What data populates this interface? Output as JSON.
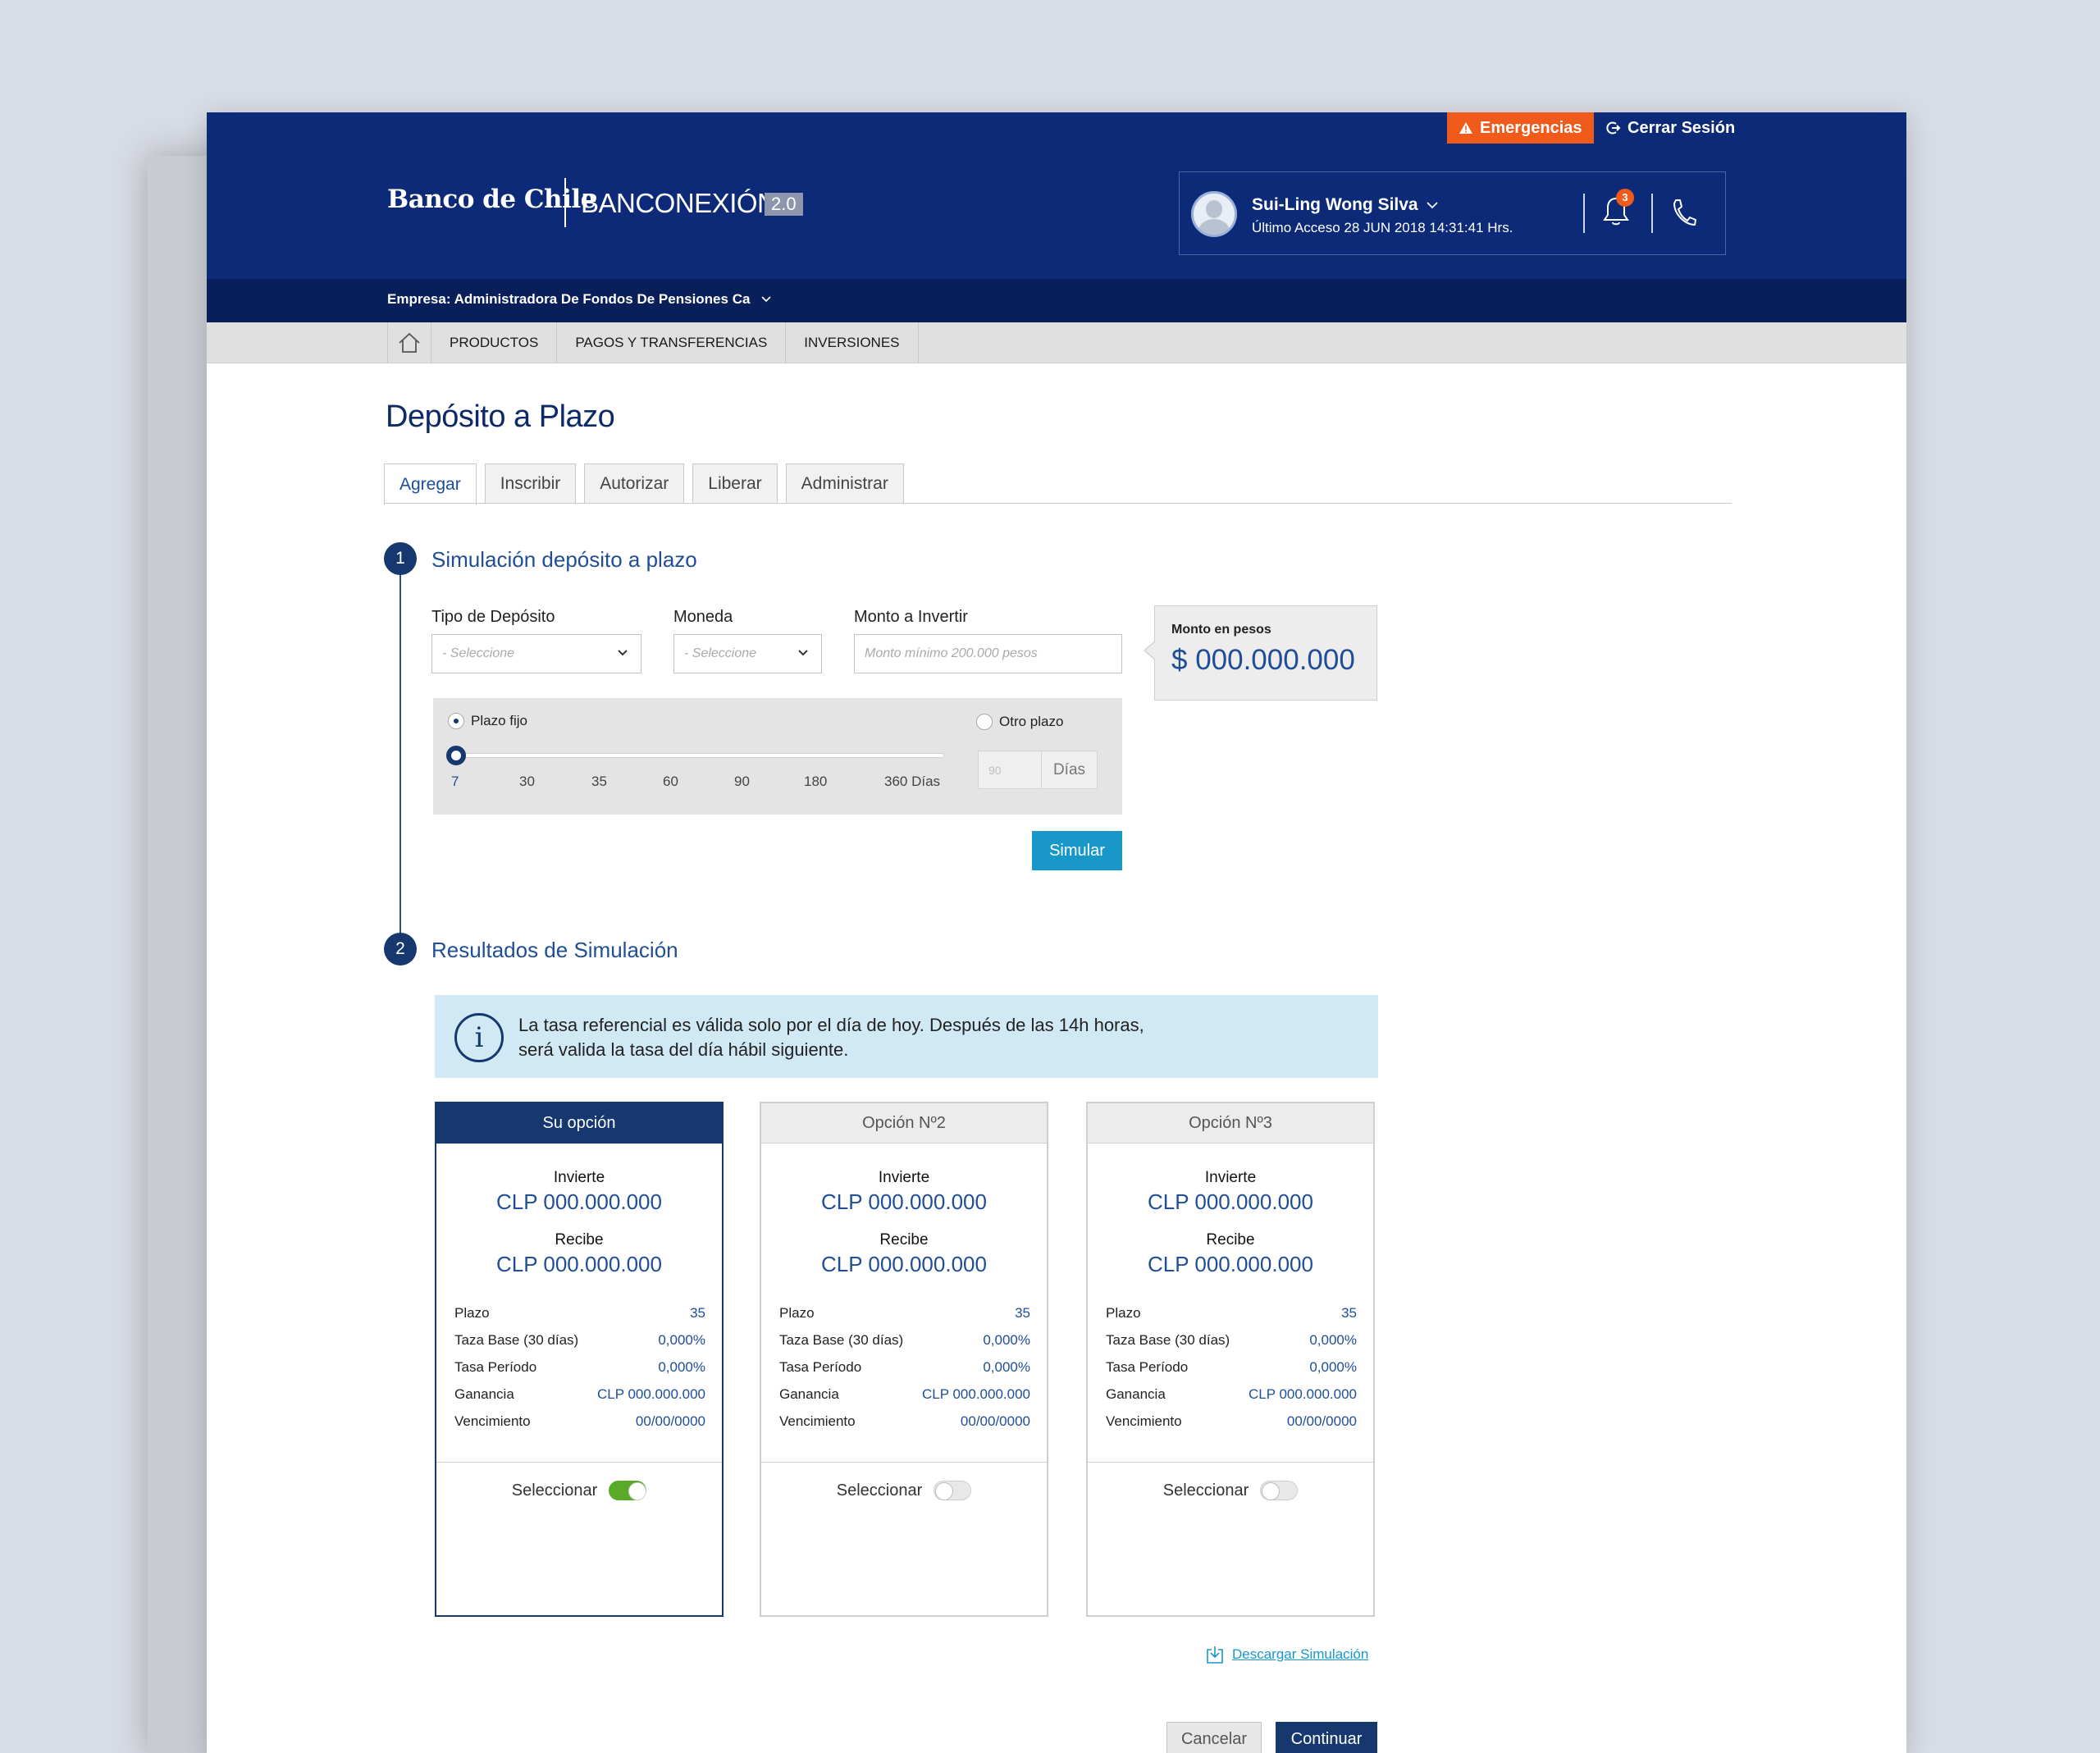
{
  "header": {
    "emergency_label": "Emergencias",
    "logout_label": "Cerrar Sesión",
    "bank_name": "Banco de Chile",
    "app_name": "BANCONEXIÓN",
    "app_version": "2.0",
    "user_name": "Sui-Ling Wong Silva",
    "last_access": "Último Acceso 28 JUN 2018 14:31:41 Hrs.",
    "notification_count": "3",
    "company": "Empresa: Administradora De Fondos De Pensiones Ca"
  },
  "nav": {
    "items": [
      "PRODUCTOS",
      "PAGOS Y TRANSFERENCIAS",
      "INVERSIONES"
    ]
  },
  "page": {
    "title": "Depósito a Plazo",
    "tabs": [
      "Agregar",
      "Inscribir",
      "Autorizar",
      "Liberar",
      "Administrar"
    ],
    "active_tab": "Agregar"
  },
  "step1": {
    "number": "1",
    "title": "Simulación depósito a plazo",
    "tipo_label": "Tipo de Depósito",
    "tipo_placeholder": "- Seleccione",
    "moneda_label": "Moneda",
    "moneda_placeholder": "- Seleccione",
    "monto_label": "Monto a Invertir",
    "monto_placeholder": "Monto mínimo 200.000 pesos",
    "monto_pesos_label": "Monto en pesos",
    "monto_pesos_value": "$ 000.000.000",
    "plazo_fijo_label": "Plazo fijo",
    "otro_plazo_label": "Otro plazo",
    "ticks": [
      "7",
      "30",
      "35",
      "60",
      "90",
      "180",
      "360 Días"
    ],
    "selected_tick": 0,
    "dias_placeholder": "90",
    "dias_unit": "Días",
    "simular_label": "Simular"
  },
  "step2": {
    "number": "2",
    "title": "Resultados de Simulación",
    "info_line1": "La tasa referencial es válida solo por el día de hoy. Después de las 14h horas,",
    "info_line2": "será valida la tasa del día hábil siguiente."
  },
  "cards": [
    {
      "title": "Su opción",
      "selected": true,
      "invierte_label": "Invierte",
      "invierte_value": "CLP 000.000.000",
      "recibe_label": "Recibe",
      "recibe_value": "CLP 000.000.000",
      "rows": [
        {
          "k": "Plazo",
          "v": "35"
        },
        {
          "k": "Taza Base (30 días)",
          "v": "0,000%"
        },
        {
          "k": "Tasa Período",
          "v": "0,000%"
        },
        {
          "k": "Ganancia",
          "v": "CLP 000.000.000"
        },
        {
          "k": "Vencimiento",
          "v": "00/00/0000"
        }
      ],
      "select_label": "Seleccionar"
    },
    {
      "title": "Opción Nº2",
      "selected": false,
      "invierte_label": "Invierte",
      "invierte_value": "CLP 000.000.000",
      "recibe_label": "Recibe",
      "recibe_value": "CLP 000.000.000",
      "rows": [
        {
          "k": "Plazo",
          "v": "35"
        },
        {
          "k": "Taza Base (30 días)",
          "v": "0,000%"
        },
        {
          "k": "Tasa Período",
          "v": "0,000%"
        },
        {
          "k": "Ganancia",
          "v": "CLP 000.000.000"
        },
        {
          "k": "Vencimiento",
          "v": "00/00/0000"
        }
      ],
      "select_label": "Seleccionar"
    },
    {
      "title": "Opción Nº3",
      "selected": false,
      "invierte_label": "Invierte",
      "invierte_value": "CLP 000.000.000",
      "recibe_label": "Recibe",
      "recibe_value": "CLP 000.000.000",
      "rows": [
        {
          "k": "Plazo",
          "v": "35"
        },
        {
          "k": "Taza Base (30 días)",
          "v": "0,000%"
        },
        {
          "k": "Tasa Período",
          "v": "0,000%"
        },
        {
          "k": "Ganancia",
          "v": "CLP 000.000.000"
        },
        {
          "k": "Vencimiento",
          "v": "00/00/0000"
        }
      ],
      "select_label": "Seleccionar"
    }
  ],
  "footer": {
    "download_label": "Descargar Simulación",
    "cancel_label": "Cancelar",
    "continue_label": "Continuar"
  },
  "colors": {
    "header_bg": "#0c2a78",
    "accent": "#16386f",
    "link": "#1798c9",
    "emergency": "#f05a1a",
    "toggle_on": "#5aaa2a"
  }
}
